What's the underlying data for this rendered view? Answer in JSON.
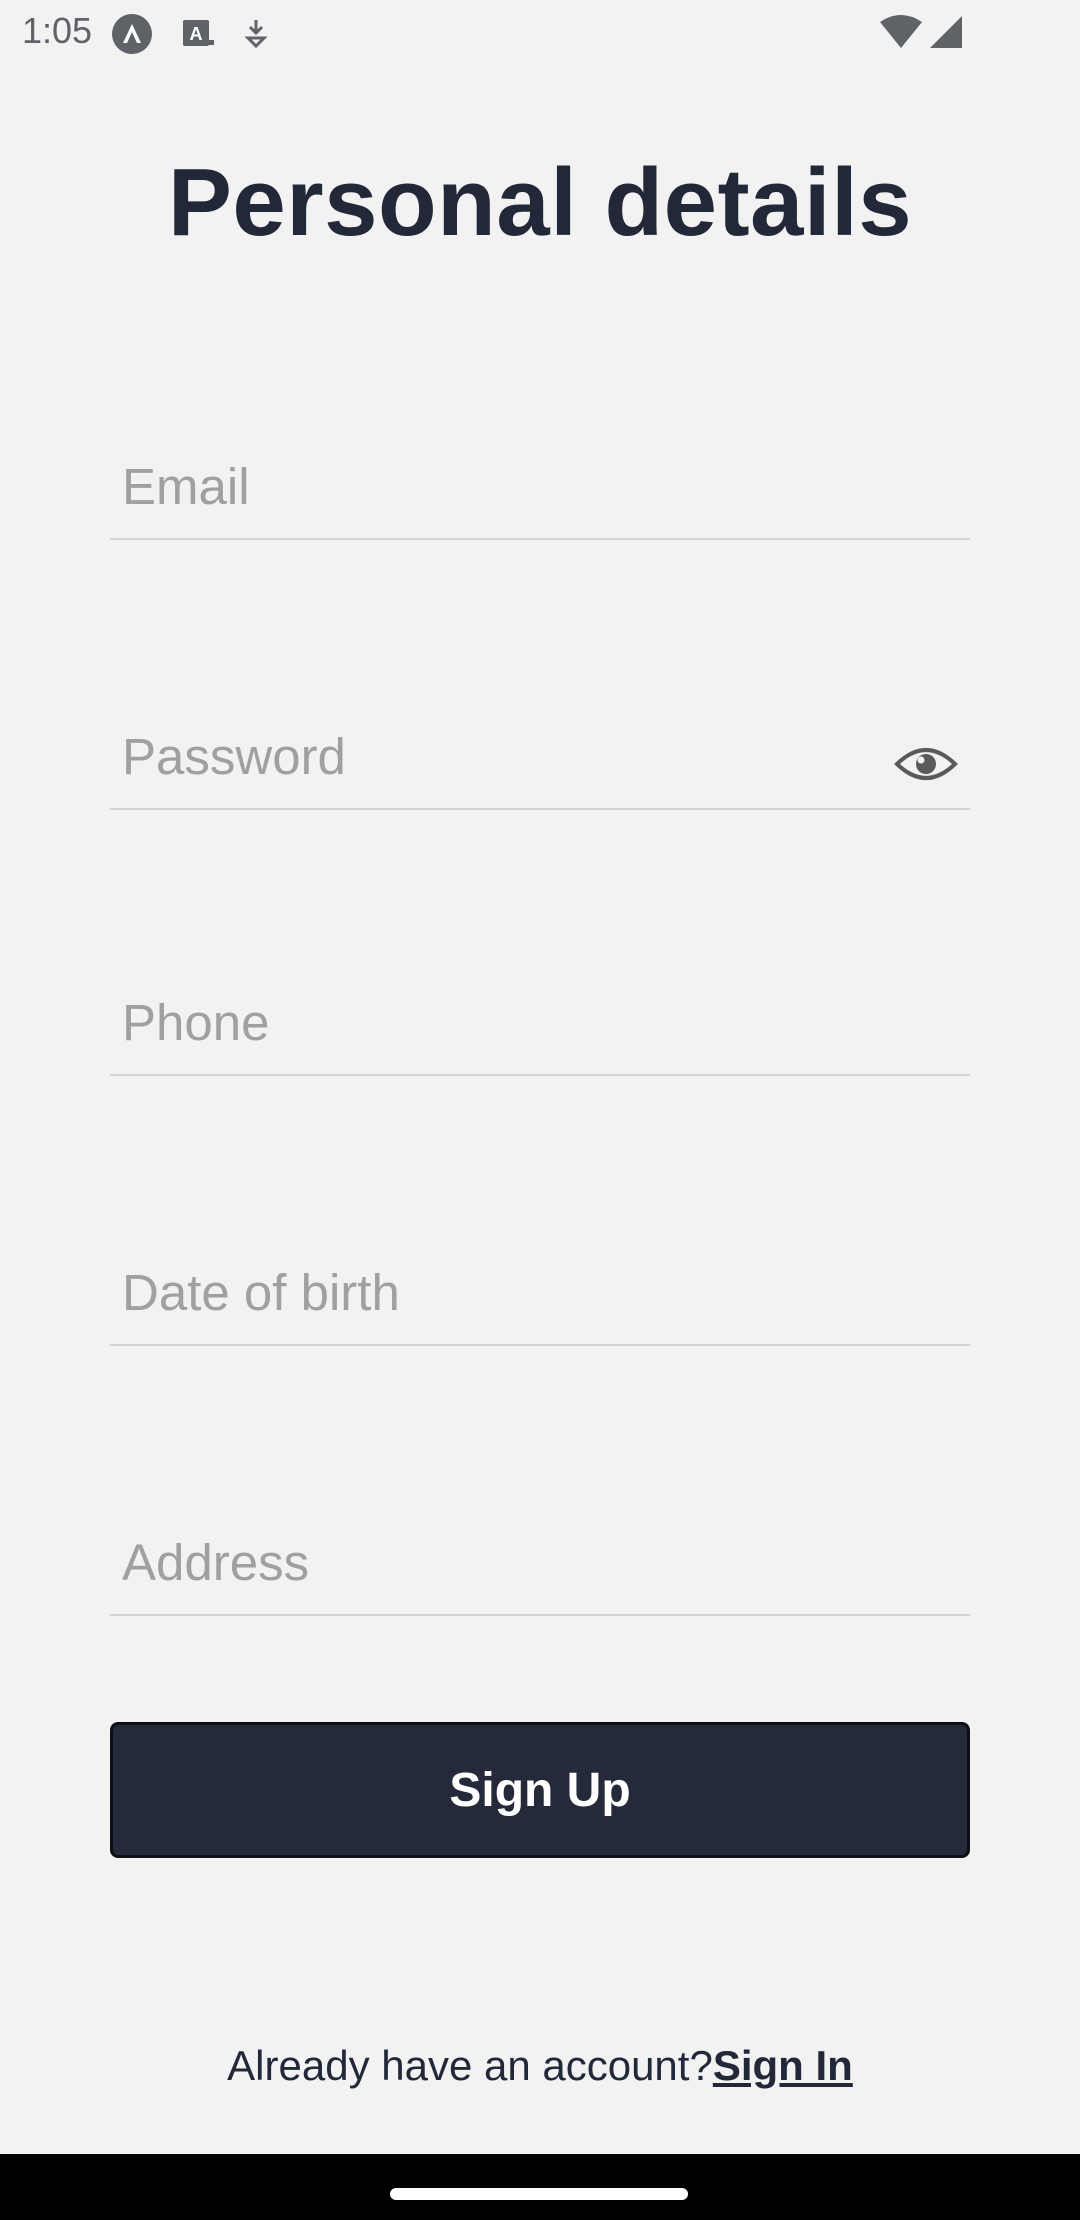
{
  "status_bar": {
    "time": "1:05",
    "icons": [
      "app-notification-icon",
      "keyboard-a-icon",
      "download-icon",
      "wifi-icon",
      "cellular-signal-icon"
    ]
  },
  "title": "Personal details",
  "form": {
    "email": {
      "placeholder": "Email",
      "value": ""
    },
    "password": {
      "placeholder": "Password",
      "value": ""
    },
    "phone": {
      "placeholder": "Phone",
      "value": ""
    },
    "dob": {
      "placeholder": "Date of birth",
      "value": ""
    },
    "address": {
      "placeholder": "Address",
      "value": ""
    }
  },
  "actions": {
    "signup_label": "Sign Up"
  },
  "footer": {
    "prompt": "Already have an account?",
    "signin_label": "Sign In"
  },
  "colors": {
    "background": "#f2f2f2",
    "primary": "#252a3a",
    "text": "#222838",
    "placeholder": "#a0a0a0"
  }
}
